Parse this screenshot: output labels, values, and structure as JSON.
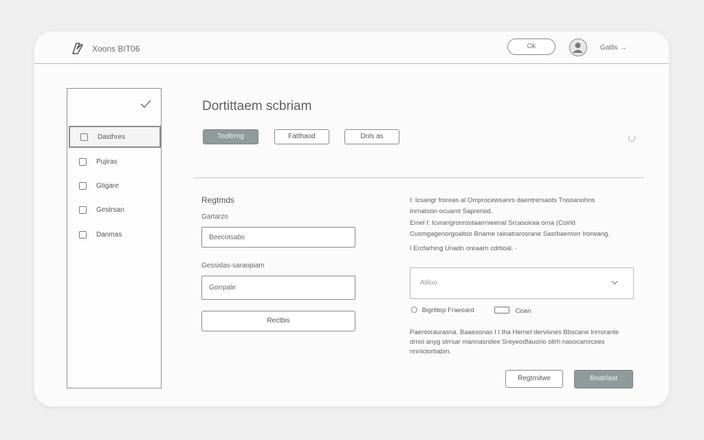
{
  "header": {
    "app_title": "Xoons BIT06",
    "pill_button_label": "Ok",
    "user_name": "Gatlis",
    "user_chevron": "→"
  },
  "sidebar": {
    "items": [
      {
        "label": "Dasthres",
        "active": true
      },
      {
        "label": "Pujiras"
      },
      {
        "label": "Gtigare"
      },
      {
        "label": "Gestrsan"
      },
      {
        "label": "Danmas"
      }
    ]
  },
  "main": {
    "page_title": "Dortittaem scbriam",
    "tabs": [
      "Tooltrrng",
      "Fatthaod",
      "Dnls as"
    ]
  },
  "form": {
    "heading": "Regtmds",
    "label_1": "Gartarzo",
    "input_1_value": "Beecotsabs",
    "label_2": "Gessidas-saraopiam",
    "input_2_value": "Gorrpale",
    "submit_label": "Rectbis"
  },
  "details": {
    "paragraph_1_line_1": "I: Icsangr froreas al Omprocewsanrs daentrersaots Tnooanohns",
    "paragraph_1_line_2": "Inrnatoon ocuamt Sapreriod.",
    "paragraph_1_line_3": "Emel I: Icvrangronrostaarrnieenal Srcasoiraa orna (Coirld",
    "paragraph_1_line_4": "Cusmgagenorgoaitoo Bnarne rainatrarosrane Sasrbaemorr Irorwang.",
    "paragraph_1_line_5": "I Ercfarhing Unadn oreaarn cdrtioal. ·",
    "select_value": "Atiloo",
    "option_radio_label": "Bigrittep Fraeoard",
    "option_toggle_label": "Coan",
    "paragraph_2_line_1": "Paentoraurasnà. Baaesonas I I tha Hernel dervisnes Bbscane Inrrorante",
    "paragraph_2_line_2": "drnol anyg strrsar mannasrolee Sreyeodfauorio ollrh nasocamrcees",
    "paragraph_2_line_3": "nnnîctorbabin.",
    "secondary_button_label": "Regtrnitwe",
    "primary_button_label": "Beatrlaat"
  }
}
